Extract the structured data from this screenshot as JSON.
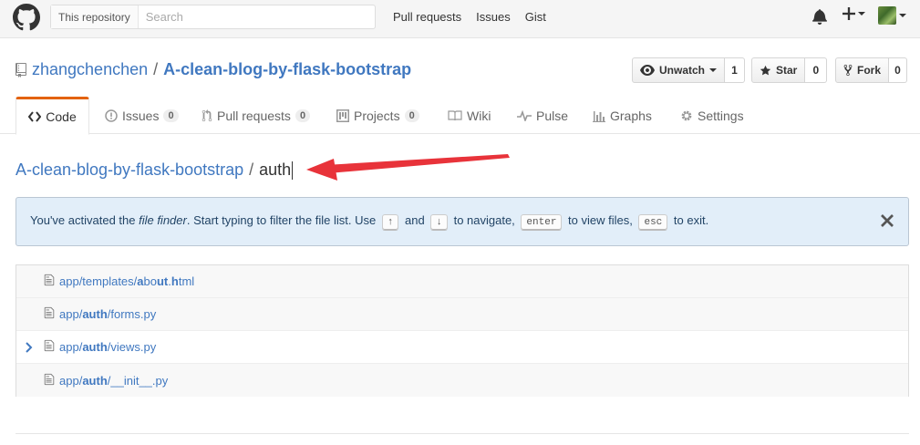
{
  "header": {
    "search_scope": "This repository",
    "search_placeholder": "Search",
    "nav": [
      "Pull requests",
      "Issues",
      "Gist"
    ],
    "plus_label": "+"
  },
  "repo": {
    "owner": "zhangchenchen",
    "separator": "/",
    "name": "A-clean-blog-by-flask-bootstrap",
    "watch": {
      "label": "Unwatch",
      "count": "1"
    },
    "star": {
      "label": "Star",
      "count": "0"
    },
    "fork": {
      "label": "Fork",
      "count": "0"
    }
  },
  "tabs": [
    {
      "label": "Code",
      "badge": null
    },
    {
      "label": "Issues",
      "badge": "0"
    },
    {
      "label": "Pull requests",
      "badge": "0"
    },
    {
      "label": "Projects",
      "badge": "0"
    },
    {
      "label": "Wiki",
      "badge": null
    },
    {
      "label": "Pulse",
      "badge": null
    },
    {
      "label": "Graphs",
      "badge": null
    },
    {
      "label": "Settings",
      "badge": null
    }
  ],
  "breadcrumb": {
    "repo": "A-clean-blog-by-flask-bootstrap",
    "separator": "/",
    "query": "auth"
  },
  "flash": {
    "part1": "You've activated the ",
    "emph": "file finder",
    "part2": ". Start typing to filter the file list. Use ",
    "key_up": "↑",
    "and": " and ",
    "key_down": "↓",
    "part3": " to navigate, ",
    "key_enter": "enter",
    "part4": " to view files, ",
    "key_esc": "esc",
    "part5": " to exit."
  },
  "files": [
    {
      "segments": [
        [
          "app/templates/",
          false
        ],
        [
          "a",
          true
        ],
        [
          "bo",
          false
        ],
        [
          "ut",
          true
        ],
        [
          ".",
          false
        ],
        [
          "h",
          true
        ],
        [
          "tml",
          false
        ]
      ],
      "active": false
    },
    {
      "segments": [
        [
          "app/",
          false
        ],
        [
          "auth",
          true
        ],
        [
          "/forms.py",
          false
        ]
      ],
      "active": false
    },
    {
      "segments": [
        [
          "app/",
          false
        ],
        [
          "auth",
          true
        ],
        [
          "/views.py",
          false
        ]
      ],
      "active": true
    },
    {
      "segments": [
        [
          "app/",
          false
        ],
        [
          "auth",
          true
        ],
        [
          "/__init__.py",
          false
        ]
      ],
      "active": false
    }
  ],
  "colors": {
    "accent": "#e36209",
    "link": "#4078c0",
    "arrow": "#e8333a",
    "flash_bg": "#e2eef9"
  }
}
